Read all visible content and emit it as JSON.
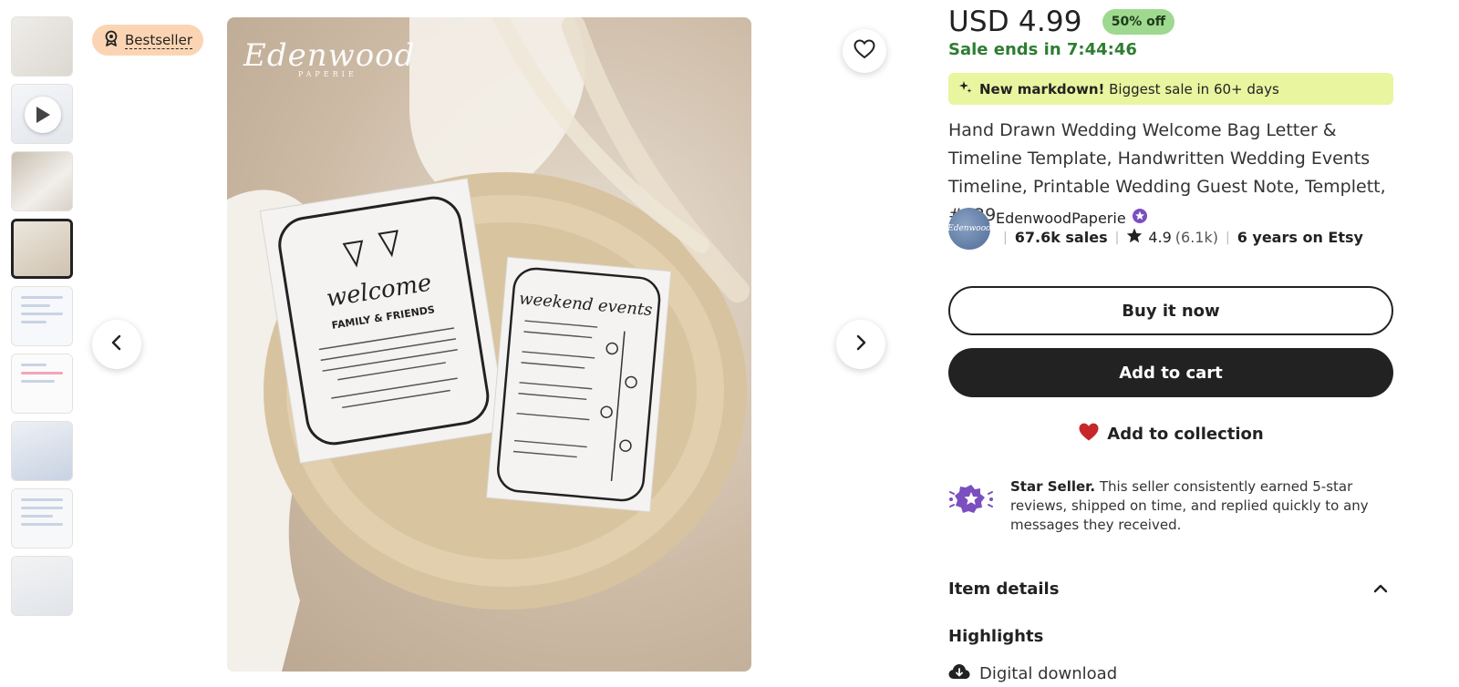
{
  "badge": {
    "label": "Bestseller",
    "icon": "award-ribbon-icon"
  },
  "gallery": {
    "thumbnails": [
      {
        "caption": ""
      },
      {
        "caption": "",
        "is_video": true
      },
      {
        "caption": ""
      },
      {
        "caption": "",
        "active": true
      },
      {
        "caption": ""
      },
      {
        "caption": ""
      },
      {
        "caption": ""
      },
      {
        "caption": ""
      },
      {
        "caption": ""
      }
    ],
    "main_image_watermark": "Edenwood",
    "main_image_watermark_sub": "PAPERIE",
    "prev_icon": "chevron-left-icon",
    "next_icon": "chevron-right-icon",
    "favorite_icon": "heart-outline-icon"
  },
  "listing": {
    "price": "USD 4.99",
    "discount": "50% off",
    "sale_ends": "Sale ends in 7:44:46",
    "markdown_bold": "New markdown!",
    "markdown_text": "Biggest sale in 60+ days",
    "title": "Hand Drawn Wedding Welcome Bag Letter & Timeline Template, Handwritten Wedding Events Timeline, Printable Wedding Guest Note, Templett, #029"
  },
  "shop": {
    "avatar_text": "Edenwood",
    "name": "EdenwoodPaperie",
    "sales": "67.6k sales",
    "rating": "4.9",
    "review_count": "(6.1k)",
    "years": "6 years on Etsy"
  },
  "actions": {
    "buy_now": "Buy it now",
    "add_to_cart": "Add to cart",
    "add_to_collection": "Add to collection"
  },
  "star_seller": {
    "label": "Star Seller.",
    "text": "This seller consistently earned 5-star reviews, shipped on time, and replied quickly to any messages they received."
  },
  "details": {
    "heading": "Item details",
    "highlights_heading": "Highlights",
    "highlight_1": "Digital download"
  },
  "colors": {
    "accent_green": "#2e7d32",
    "discount_bg": "#9ed98f",
    "markdown_bg": "#e9f59f",
    "badge_bg": "#fbd5b3",
    "star_purple": "#7b4fbf",
    "heart_red": "#c62828"
  }
}
